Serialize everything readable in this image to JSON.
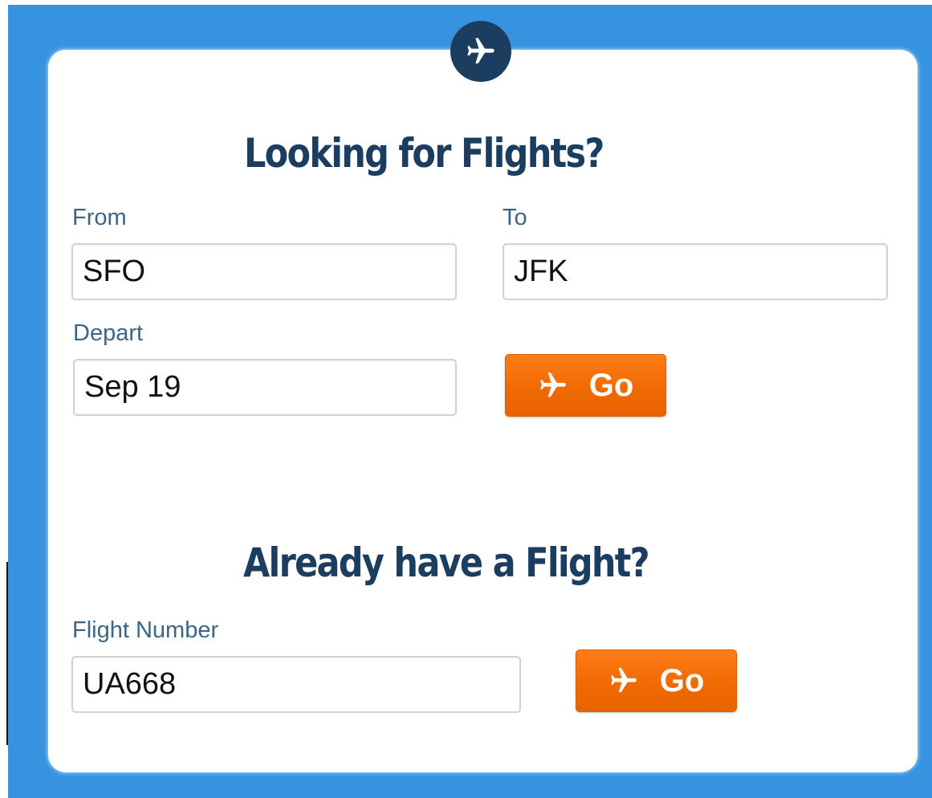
{
  "badge": {
    "icon": "airplane-icon"
  },
  "search": {
    "heading": "Looking for Flights?",
    "from_label": "From",
    "from_value": "SFO",
    "to_label": "To",
    "to_value": "JFK",
    "depart_label": "Depart",
    "depart_value": "Sep 19",
    "go_label": "Go",
    "go_icon": "airplane-icon"
  },
  "lookup": {
    "heading": "Already have a Flight?",
    "flight_number_label": "Flight Number",
    "flight_number_value": "UA668",
    "go_label": "Go",
    "go_icon": "airplane-icon"
  },
  "colors": {
    "background": "#3593e0",
    "card": "#ffffff",
    "heading": "#1b3e60",
    "label": "#3d6586",
    "button": "#f06a00"
  }
}
